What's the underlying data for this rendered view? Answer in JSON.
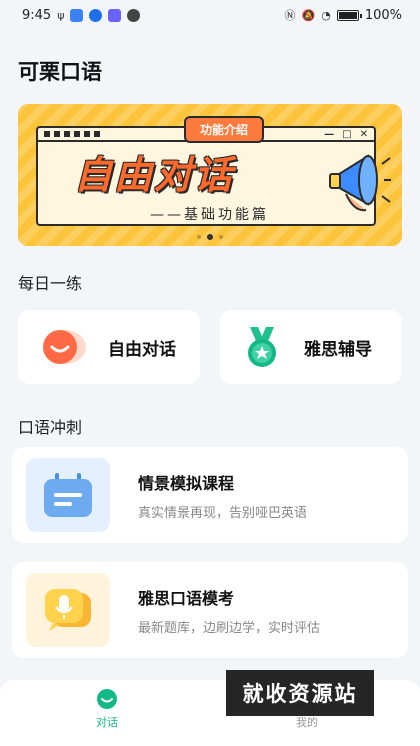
{
  "status_bar": {
    "time": "9:45",
    "battery": "100%"
  },
  "app": {
    "title": "可栗口语"
  },
  "banner": {
    "tag": "功能介绍",
    "headline": "自由对话",
    "subtitle": "——基础功能篇"
  },
  "daily": {
    "heading": "每日一练",
    "cards": [
      {
        "label": "自由对话",
        "icon": "smile-icon"
      },
      {
        "label": "雅思辅导",
        "icon": "medal-icon"
      }
    ]
  },
  "sprint": {
    "heading": "口语冲刺",
    "courses": [
      {
        "title": "情景模拟课程",
        "desc": "真实情景再现，告别哑巴英语",
        "icon": "calendar-icon"
      },
      {
        "title": "雅思口语模考",
        "desc": "最新题库，边刷边学，实时评估",
        "icon": "microphone-chat-icon"
      }
    ]
  },
  "bottom_nav": {
    "items": [
      {
        "label": "对话",
        "active": true
      },
      {
        "label": "我的",
        "active": false
      }
    ]
  },
  "watermark": "就收资源站",
  "colors": {
    "accent": "#12b886",
    "orange": "#ff6a2c",
    "banner_bg": "#fbc43a"
  }
}
